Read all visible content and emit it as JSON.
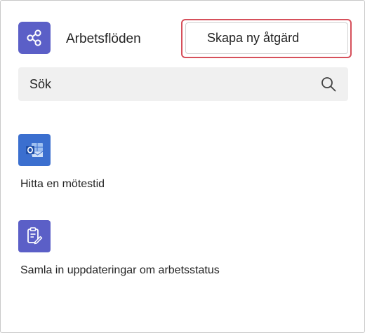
{
  "header": {
    "title": "Arbetsflöden",
    "app_icon": "workflows-share-icon",
    "accent_color": "#5b5fc7"
  },
  "actions": {
    "create_label": "Skapa ny åtgärd",
    "focus_color": "#d6505b"
  },
  "search": {
    "placeholder": "Sök",
    "value": "",
    "icon": "search-icon"
  },
  "workflows": [
    {
      "label": "Hitta en mötestid",
      "icon": "outlook-calendar-icon",
      "color": "#3b6fcf"
    },
    {
      "label": "Samla in uppdateringar om arbetsstatus",
      "icon": "clipboard-edit-icon",
      "color": "#5b5fc7"
    }
  ]
}
